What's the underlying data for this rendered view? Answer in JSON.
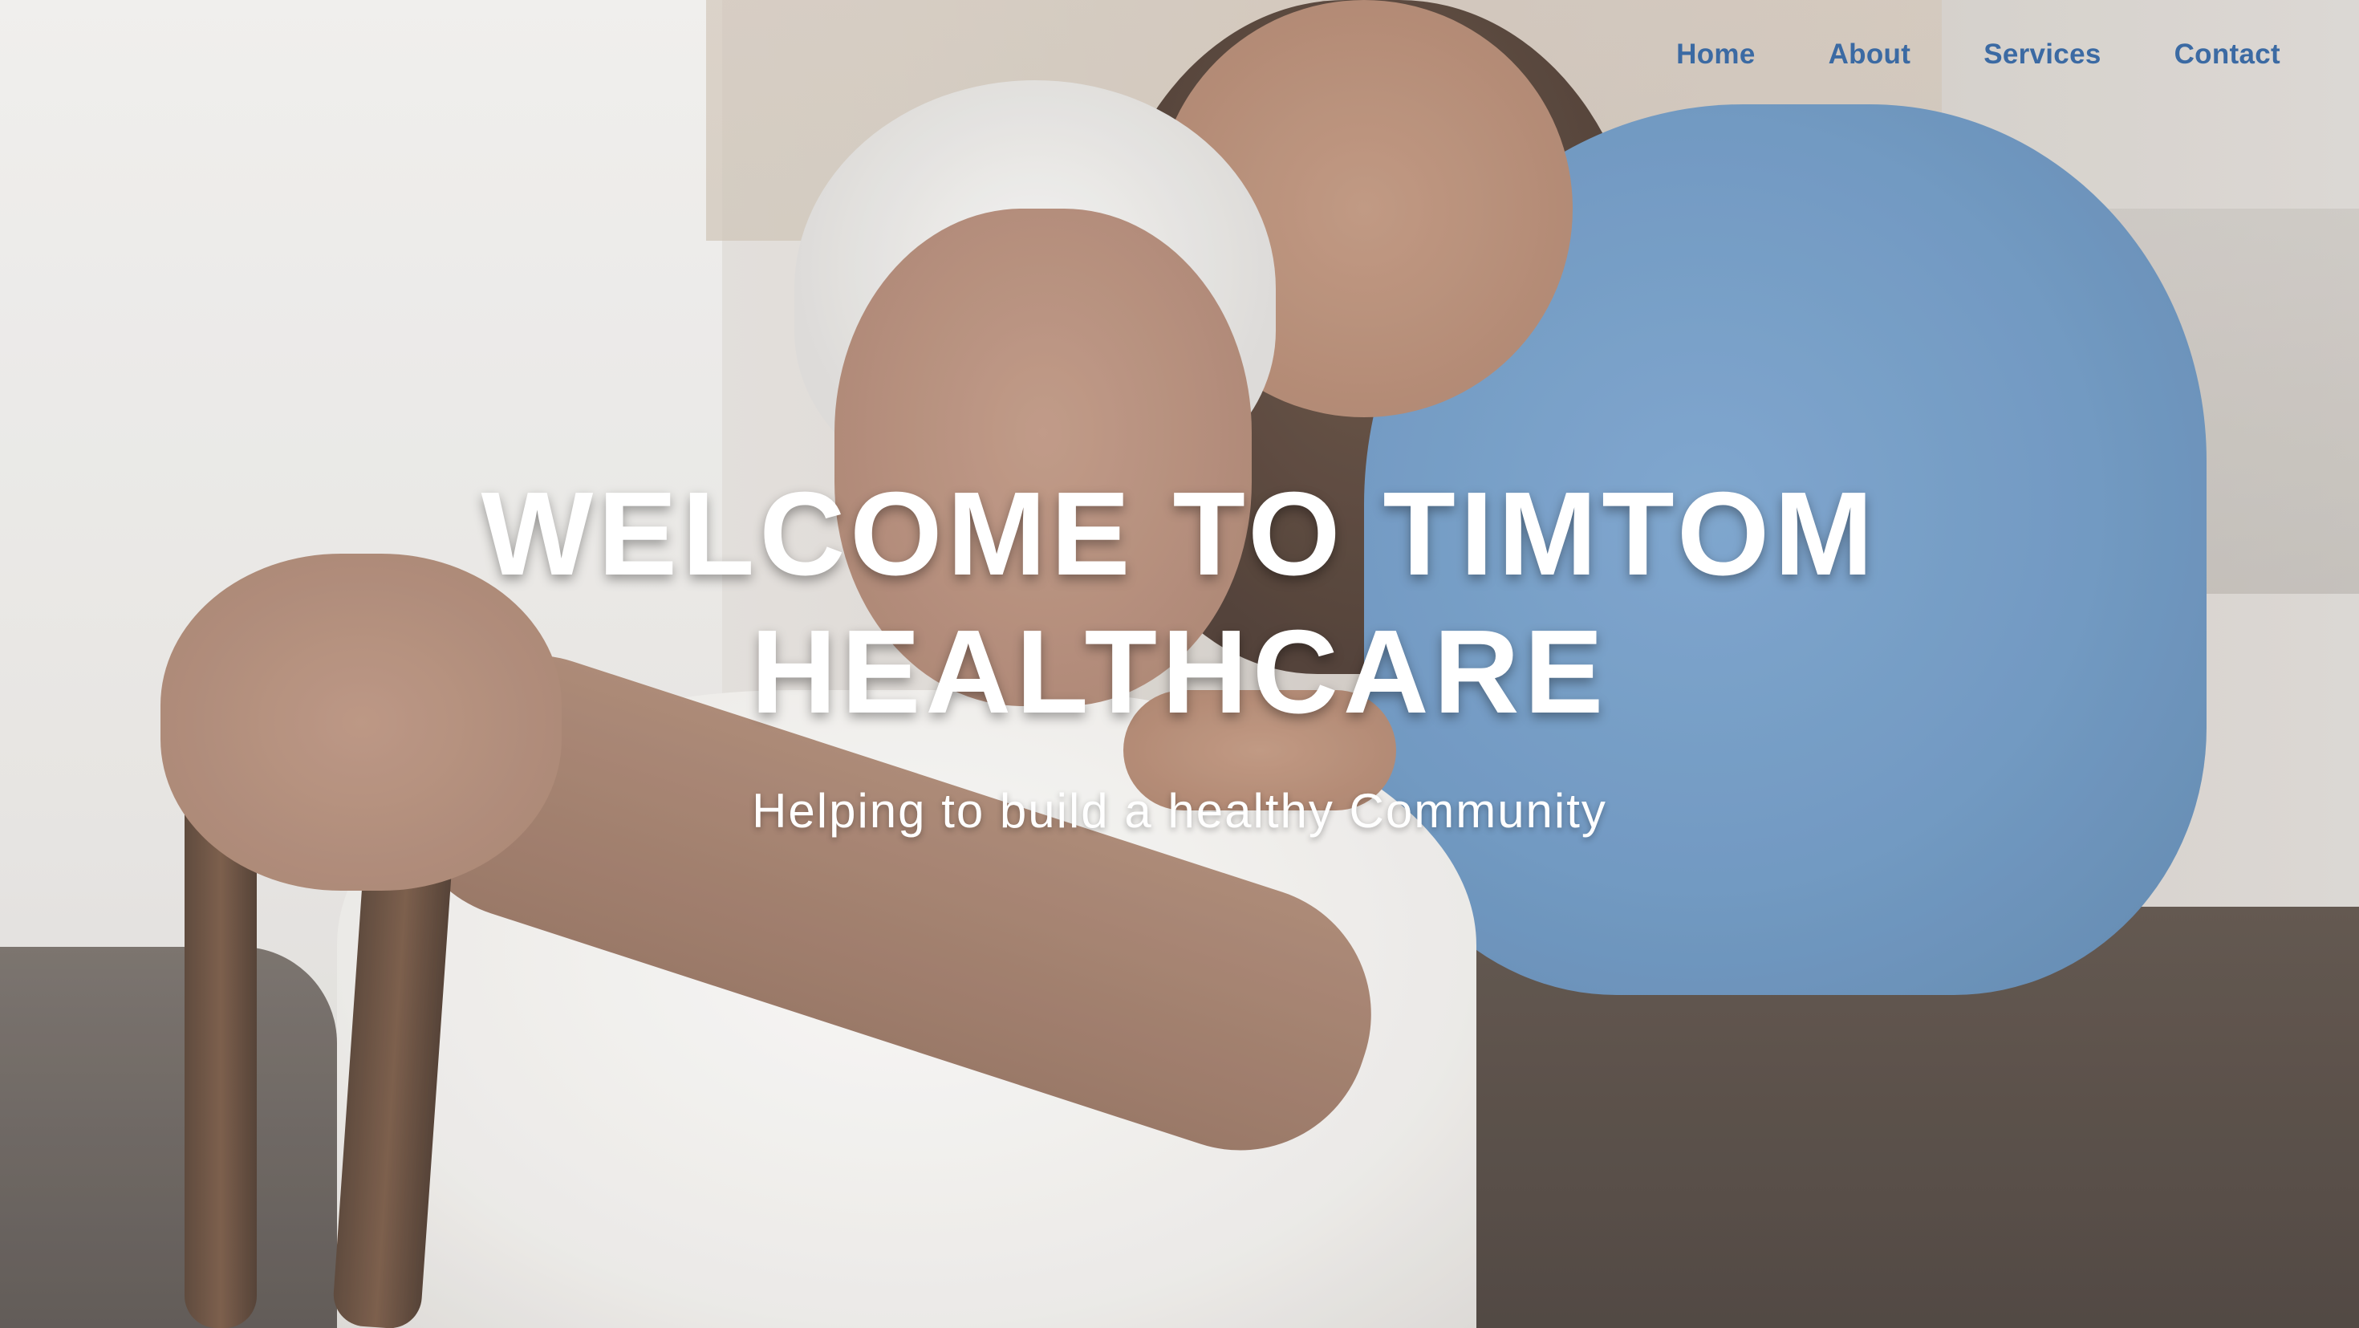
{
  "nav": {
    "items": [
      {
        "label": "Home"
      },
      {
        "label": "About"
      },
      {
        "label": "Services"
      },
      {
        "label": "Contact"
      }
    ],
    "color": "#3b6aa3"
  },
  "hero": {
    "title_line1": "WELCOME TO TIMTOM",
    "title_line2": "HEALTHCARE",
    "subtitle": "Helping to build a healthy Community"
  }
}
